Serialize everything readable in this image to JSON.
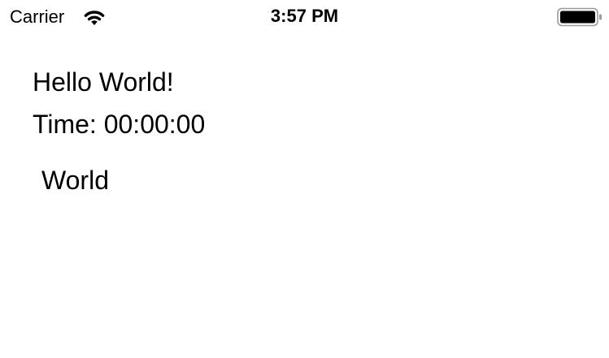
{
  "status_bar": {
    "carrier": "Carrier",
    "time": "3:57 PM",
    "wifi_icon": "wifi-icon",
    "battery_icon": "battery-icon",
    "battery_level": 1.0
  },
  "main": {
    "greeting": "Hello World!",
    "timer": "Time: 00:00:00",
    "world_label": "World"
  }
}
